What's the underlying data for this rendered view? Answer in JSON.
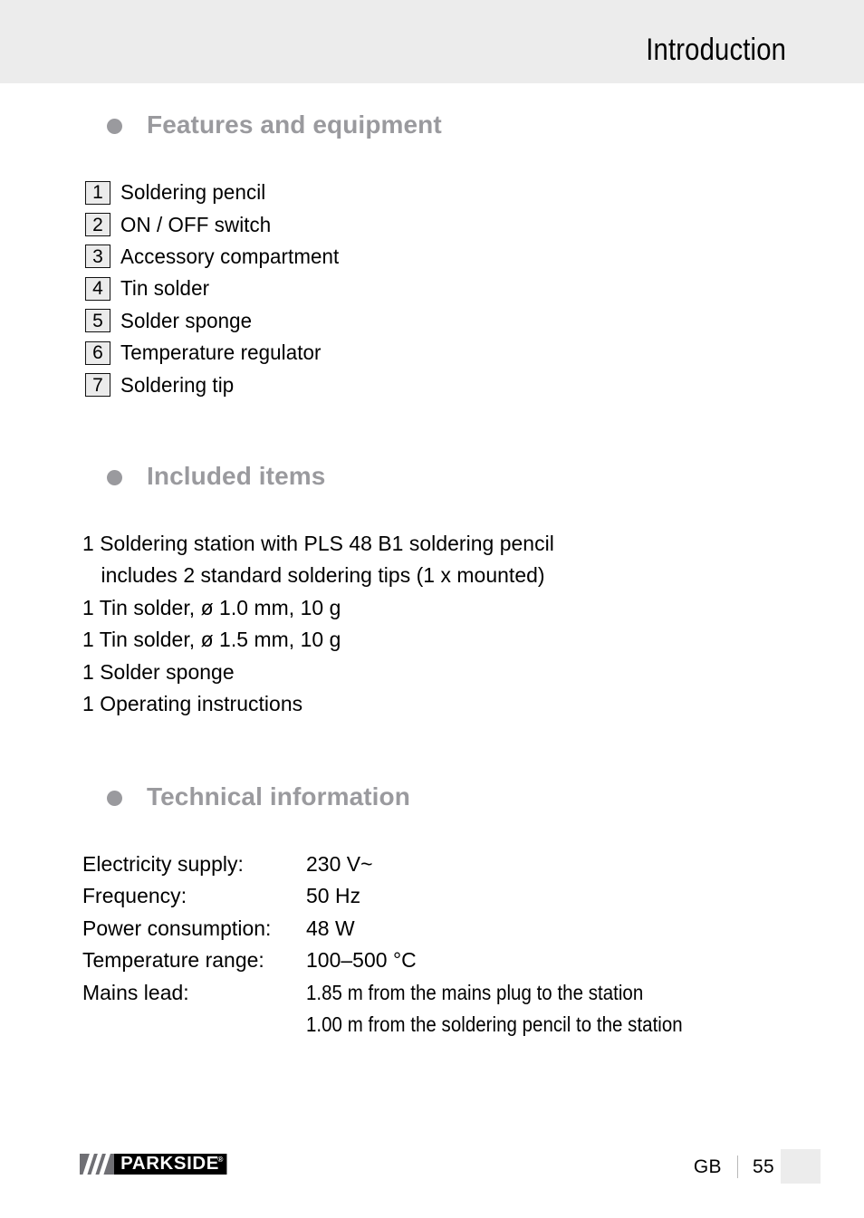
{
  "header": {
    "title": "Introduction"
  },
  "sections": [
    {
      "id": "features",
      "heading": "Features and equipment"
    },
    {
      "id": "included",
      "heading": "Included items"
    },
    {
      "id": "technical",
      "heading": "Technical information"
    }
  ],
  "features": {
    "items": [
      {
        "num": "1",
        "label": "Soldering pencil"
      },
      {
        "num": "2",
        "label": "ON / OFF switch"
      },
      {
        "num": "3",
        "label": "Accessory compartment"
      },
      {
        "num": "4",
        "label": "Tin solder"
      },
      {
        "num": "5",
        "label": "Solder sponge"
      },
      {
        "num": "6",
        "label": "Temperature regulator"
      },
      {
        "num": "7",
        "label": "Soldering tip"
      }
    ]
  },
  "included": {
    "lines": [
      "1 Soldering station with PLS 48 B1 soldering pencil",
      "includes 2 standard soldering tips (1 x mounted)",
      "1 Tin solder, ø 1.0 mm, 10 g",
      "1 Tin solder, ø 1.5 mm, 10 g",
      "1 Solder sponge",
      "1 Operating instructions"
    ]
  },
  "technical": {
    "rows": [
      {
        "label": "Electricity supply:",
        "value": "230 V~"
      },
      {
        "label": "Frequency:",
        "value": "50 Hz"
      },
      {
        "label": "Power consumption:",
        "value": "48 W"
      },
      {
        "label": "Temperature range:",
        "value": "100–500 °C"
      },
      {
        "label": "Mains lead:",
        "value": "1.85 m from the mains plug to the station"
      },
      {
        "label": "",
        "value": "1.00 m from the soldering pencil to the station"
      }
    ]
  },
  "footer": {
    "brand": "PARKSIDE",
    "registered": "®",
    "language": "GB",
    "page_number": "55"
  },
  "colors": {
    "header_band": "#ececec",
    "heading_gray": "#9a9a9e",
    "num_box_fill": "#ebebeb",
    "logo_slash_block": "#6f6f74",
    "logo_word_block": "#000000"
  }
}
